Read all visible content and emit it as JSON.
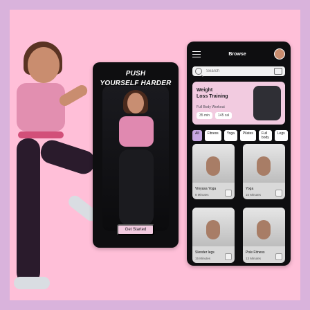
{
  "phones": {
    "left": {
      "headline_line1": "PUSH",
      "headline_line2": "YOURSELF HARDER",
      "cta_label": "Get Started"
    },
    "right": {
      "header_title": "Browse",
      "search": {
        "placeholder": "Search"
      },
      "promo": {
        "title_line1": "Weight",
        "title_line2": "Loss Training",
        "subtitle": "Full Body Workout",
        "chips": [
          "35 min",
          "145 cal"
        ]
      },
      "tags": [
        {
          "label": "All",
          "active": true
        },
        {
          "label": "Fitness",
          "active": false
        },
        {
          "label": "Yoga",
          "active": false
        },
        {
          "label": "Pilates",
          "active": false
        },
        {
          "label": "Full body",
          "active": false
        },
        {
          "label": "Legs",
          "active": false
        }
      ],
      "cards": [
        {
          "title": "Vinyasa Yoga",
          "meta": "8 Minutes"
        },
        {
          "title": "Yoga",
          "meta": "15 Minutes"
        },
        {
          "title": "Slender legs",
          "meta": "15 Minutes"
        },
        {
          "title": "Pole Fitness",
          "meta": "13 Minutes"
        }
      ]
    }
  }
}
